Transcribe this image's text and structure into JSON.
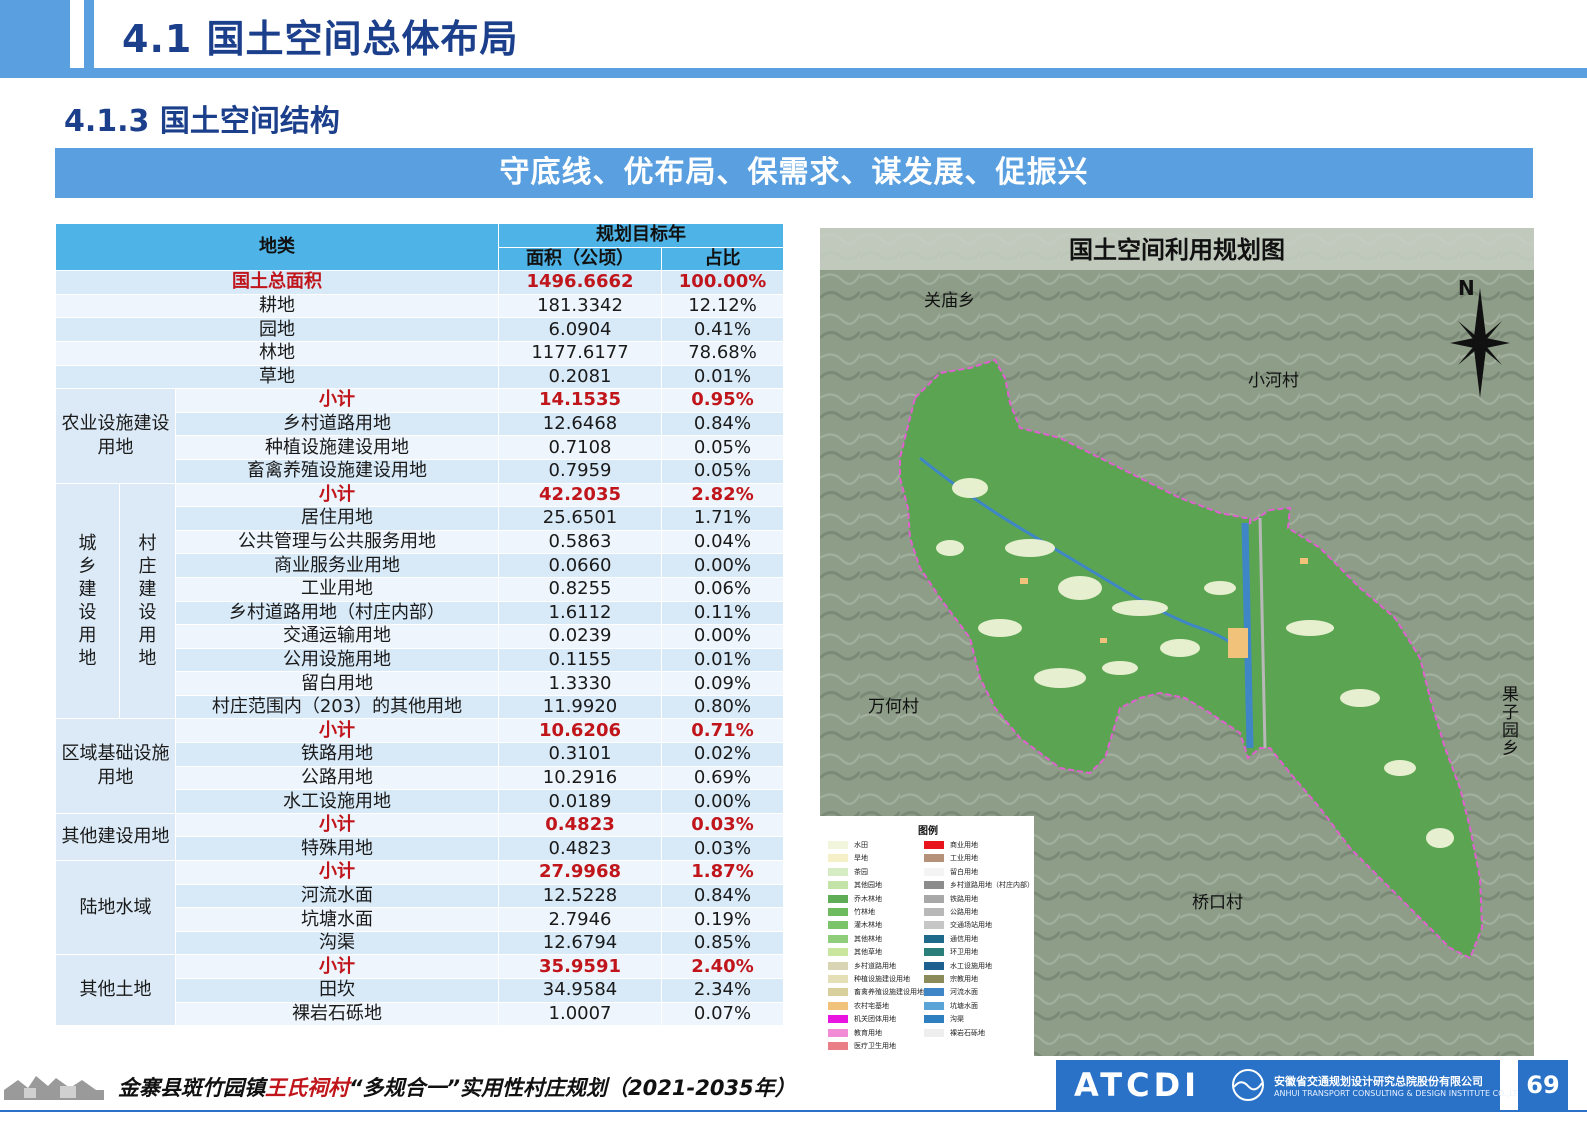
{
  "header": {
    "title": "4.1 国土空间总体布局",
    "subtitle": "4.1.3 国土空间结构",
    "banner": "守底线、优布局、保需求、谋发展、促振兴"
  },
  "table": {
    "header_category": "地类",
    "header_target": "规划目标年",
    "header_area": "面积（公顷）",
    "header_ratio": "占比",
    "total": {
      "label": "国土总面积",
      "area": "1496.6662",
      "ratio": "100.00%"
    },
    "top_rows": [
      {
        "label": "耕地",
        "area": "181.3342",
        "ratio": "12.12%"
      },
      {
        "label": "园地",
        "area": "6.0904",
        "ratio": "0.41%"
      },
      {
        "label": "林地",
        "area": "1177.6177",
        "ratio": "78.68%"
      },
      {
        "label": "草地",
        "area": "0.2081",
        "ratio": "0.01%"
      }
    ],
    "groups": [
      {
        "name": "农业设施建设用地",
        "subtotal": {
          "label": "小计",
          "area": "14.1535",
          "ratio": "0.95%"
        },
        "rows": [
          {
            "label": "乡村道路用地",
            "area": "12.6468",
            "ratio": "0.84%"
          },
          {
            "label": "种植设施建设用地",
            "area": "0.7108",
            "ratio": "0.05%"
          },
          {
            "label": "畜禽养殖设施建设用地",
            "area": "0.7959",
            "ratio": "0.05%"
          }
        ]
      },
      {
        "name": "城乡建设用地",
        "subname": "村庄建设用地",
        "subtotal": {
          "label": "小计",
          "area": "42.2035",
          "ratio": "2.82%"
        },
        "rows": [
          {
            "label": "居住用地",
            "area": "25.6501",
            "ratio": "1.71%"
          },
          {
            "label": "公共管理与公共服务用地",
            "area": "0.5863",
            "ratio": "0.04%"
          },
          {
            "label": "商业服务业用地",
            "area": "0.0660",
            "ratio": "0.00%"
          },
          {
            "label": "工业用地",
            "area": "0.8255",
            "ratio": "0.06%"
          },
          {
            "label": "乡村道路用地（村庄内部）",
            "area": "1.6112",
            "ratio": "0.11%"
          },
          {
            "label": "交通运输用地",
            "area": "0.0239",
            "ratio": "0.00%"
          },
          {
            "label": "公用设施用地",
            "area": "0.1155",
            "ratio": "0.01%"
          },
          {
            "label": "留白用地",
            "area": "1.3330",
            "ratio": "0.09%"
          },
          {
            "label": "村庄范围内（203）的其他用地",
            "area": "11.9920",
            "ratio": "0.80%"
          }
        ]
      },
      {
        "name": "区域基础设施用地",
        "subtotal": {
          "label": "小计",
          "area": "10.6206",
          "ratio": "0.71%"
        },
        "rows": [
          {
            "label": "铁路用地",
            "area": "0.3101",
            "ratio": "0.02%"
          },
          {
            "label": "公路用地",
            "area": "10.2916",
            "ratio": "0.69%"
          },
          {
            "label": "水工设施用地",
            "area": "0.0189",
            "ratio": "0.00%"
          }
        ]
      },
      {
        "name": "其他建设用地",
        "subtotal": {
          "label": "小计",
          "area": "0.4823",
          "ratio": "0.03%"
        },
        "rows": [
          {
            "label": "特殊用地",
            "area": "0.4823",
            "ratio": "0.03%"
          }
        ]
      },
      {
        "name": "陆地水域",
        "subtotal": {
          "label": "小计",
          "area": "27.9968",
          "ratio": "1.87%"
        },
        "rows": [
          {
            "label": "河流水面",
            "area": "12.5228",
            "ratio": "0.84%"
          },
          {
            "label": "坑塘水面",
            "area": "2.7946",
            "ratio": "0.19%"
          },
          {
            "label": "沟渠",
            "area": "12.6794",
            "ratio": "0.85%"
          }
        ]
      },
      {
        "name": "其他土地",
        "subtotal": {
          "label": "小计",
          "area": "35.9591",
          "ratio": "2.40%"
        },
        "rows": [
          {
            "label": "田坎",
            "area": "34.9584",
            "ratio": "2.34%"
          },
          {
            "label": "裸岩石砾地",
            "area": "1.0007",
            "ratio": "0.07%"
          }
        ]
      }
    ]
  },
  "map": {
    "title": "国土空间利用规划图",
    "north": "N",
    "places": [
      "关庙乡",
      "小河村",
      "万何村",
      "果子园乡",
      "桥口村"
    ],
    "legend_title": "图例",
    "legend_left": [
      {
        "label": "水田",
        "color": "#f1f5dc"
      },
      {
        "label": "旱地",
        "color": "#f6f0c8"
      },
      {
        "label": "茶园",
        "color": "#d6ecc4"
      },
      {
        "label": "其他园地",
        "color": "#c3e3a8"
      },
      {
        "label": "乔木林地",
        "color": "#5fae57"
      },
      {
        "label": "竹林地",
        "color": "#6fbb5f"
      },
      {
        "label": "灌木林地",
        "color": "#7cc46a"
      },
      {
        "label": "其他林地",
        "color": "#8fcd7a"
      },
      {
        "label": "其他草地",
        "color": "#c8e69e"
      },
      {
        "label": "乡村道路用地",
        "color": "#d9d5b4"
      },
      {
        "label": "种植设施建设用地",
        "color": "#e4dfb6"
      },
      {
        "label": "畜禽养殖设施建设用地",
        "color": "#d8cf9c"
      },
      {
        "label": "农村宅基地",
        "color": "#f0c27a"
      },
      {
        "label": "机关团体用地",
        "color": "#e815e0"
      },
      {
        "label": "教育用地",
        "color": "#f28bd5"
      },
      {
        "label": "医疗卫生用地",
        "color": "#e97e86"
      }
    ],
    "legend_right": [
      {
        "label": "商业用地",
        "color": "#e8141c"
      },
      {
        "label": "工业用地",
        "color": "#b5917a"
      },
      {
        "label": "留白用地",
        "color": "#f4f4f4"
      },
      {
        "label": "乡村道路用地（村庄内部）",
        "color": "#8c8c8c"
      },
      {
        "label": "铁路用地",
        "color": "#a8a8a8"
      },
      {
        "label": "公路用地",
        "color": "#b8b8b8"
      },
      {
        "label": "交通场站用地",
        "color": "#c6c6c6"
      },
      {
        "label": "通信用地",
        "color": "#1f6a8a"
      },
      {
        "label": "环卫用地",
        "color": "#2a7f7a"
      },
      {
        "label": "水工设施用地",
        "color": "#1d5f8f"
      },
      {
        "label": "宗教用地",
        "color": "#8a8a5a"
      },
      {
        "label": "河流水面",
        "color": "#3f86c6"
      },
      {
        "label": "坑塘水面",
        "color": "#5aa3d6"
      },
      {
        "label": "沟渠",
        "color": "#2e7fbf"
      },
      {
        "label": "裸岩石砾地",
        "color": "#eeeeee"
      }
    ]
  },
  "footer": {
    "project_prefix": "金寨县斑竹园镇",
    "project_highlight": "王氏祠村",
    "project_suffix": "“多规合一”实用性村庄规划（2021-2035年）",
    "company_logo": "ATCDI",
    "company_cn": "安徽省交通规划设计研究总院股份有限公司",
    "company_en": "ANHUI TRANSPORT CONSULTING & DESIGN INSTITUTE CO.,LTD.",
    "page_number": "69"
  },
  "colors": {
    "accent": "#5aa0e0",
    "title": "#1c3f8c",
    "highlight": "#c0151b",
    "table_header": "#4eb3e6",
    "logo_bg": "#2a72c8"
  }
}
